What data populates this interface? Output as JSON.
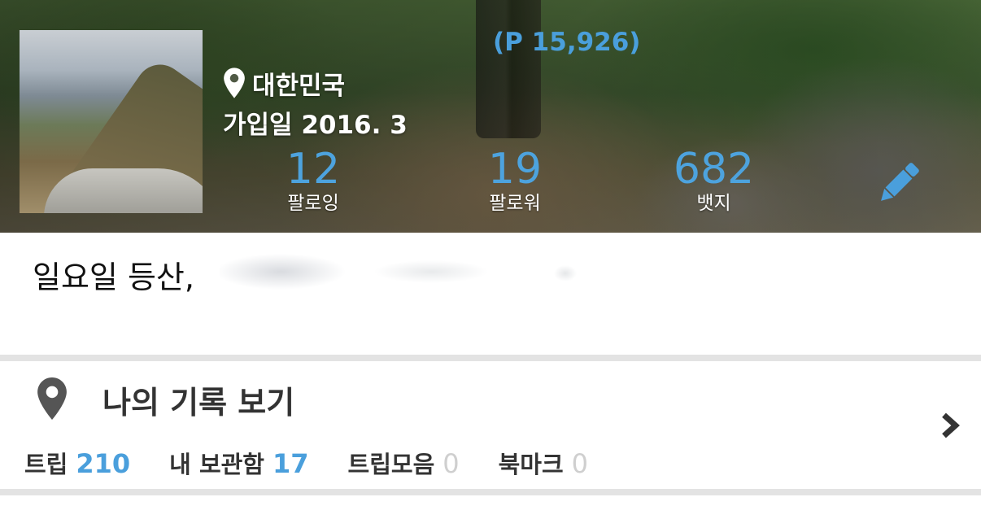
{
  "profile": {
    "location": "대한민국",
    "joined": "가입일 2016. 3",
    "points": "(P 15,926)",
    "stats": [
      {
        "value": "12",
        "label": "팔로잉"
      },
      {
        "value": "19",
        "label": "팔로워"
      },
      {
        "value": "682",
        "label": "뱃지"
      }
    ],
    "bio": "일요일 등산,"
  },
  "records": {
    "title": "나의 기록 보기",
    "items": [
      {
        "label": "트립",
        "value": "210"
      },
      {
        "label": "내 보관함",
        "value": "17"
      },
      {
        "label": "트립모음",
        "value": "0"
      },
      {
        "label": "북마크",
        "value": "0"
      }
    ]
  },
  "colors": {
    "accent": "#4a9fdc",
    "zero_count": "#cfcfcf",
    "divider": "#e3e3e3"
  },
  "icons": {
    "location": "map-pin-icon",
    "edit": "pencil-icon",
    "records": "map-pin-icon",
    "more": "chevron-right-icon"
  }
}
